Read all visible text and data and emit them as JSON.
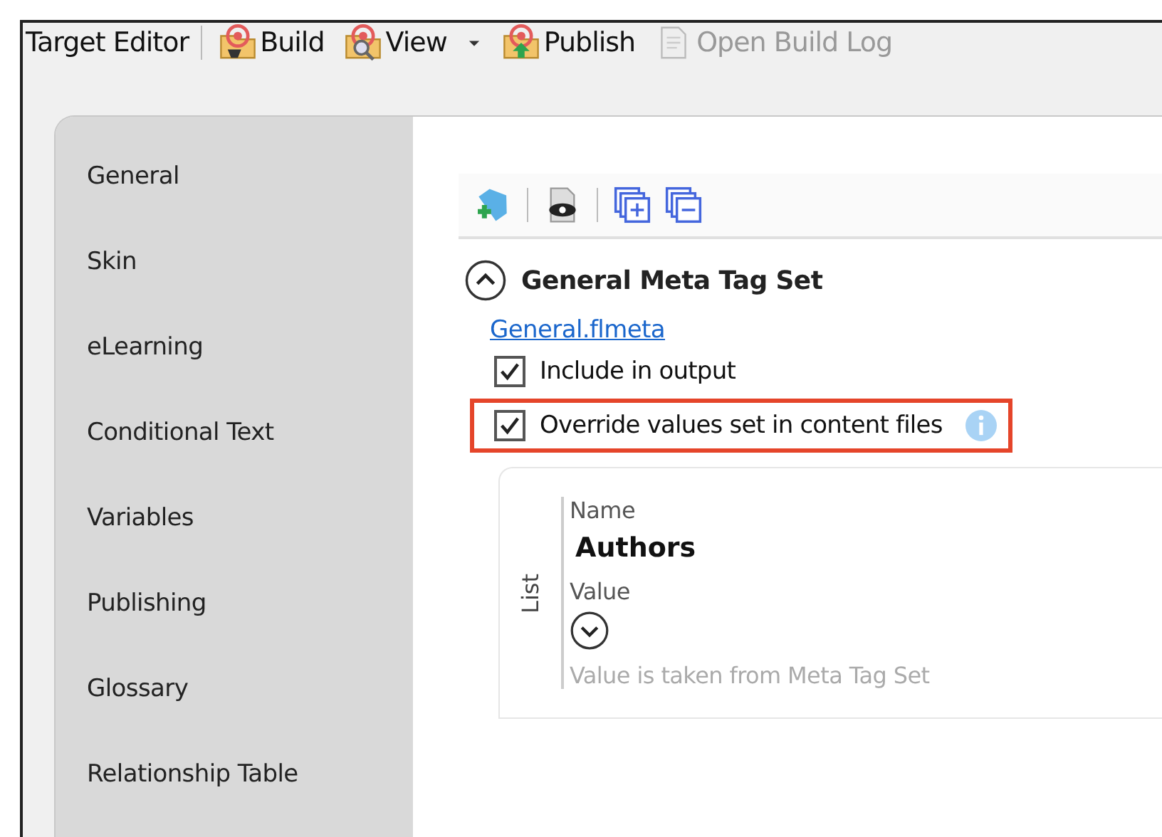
{
  "toolbar": {
    "title": "Target Editor",
    "buttons": [
      {
        "label": "Build",
        "kind": "build",
        "disabled": false
      },
      {
        "label": "View",
        "kind": "view",
        "disabled": false
      },
      {
        "label": "Publish",
        "kind": "publish",
        "disabled": false
      },
      {
        "label": "Open Build Log",
        "kind": "log",
        "disabled": true
      }
    ]
  },
  "sidebar": {
    "items": [
      {
        "label": "General"
      },
      {
        "label": "Skin"
      },
      {
        "label": "eLearning"
      },
      {
        "label": "Conditional Text"
      },
      {
        "label": "Variables"
      },
      {
        "label": "Publishing"
      },
      {
        "label": "Glossary"
      },
      {
        "label": "Relationship Table"
      }
    ]
  },
  "section": {
    "title": "General Meta Tag Set",
    "expanded": true,
    "link": "General.flmeta",
    "options": [
      {
        "label": "Include in output",
        "checked": true,
        "highlighted": false,
        "info": false
      },
      {
        "label": "Override values set in content files",
        "checked": true,
        "highlighted": true,
        "info": true
      }
    ],
    "entry": {
      "group_label": "List",
      "name_label": "Name",
      "name": "Authors",
      "value_label": "Value",
      "value_expanded": false,
      "note": "Value is taken from Meta Tag Set"
    }
  }
}
